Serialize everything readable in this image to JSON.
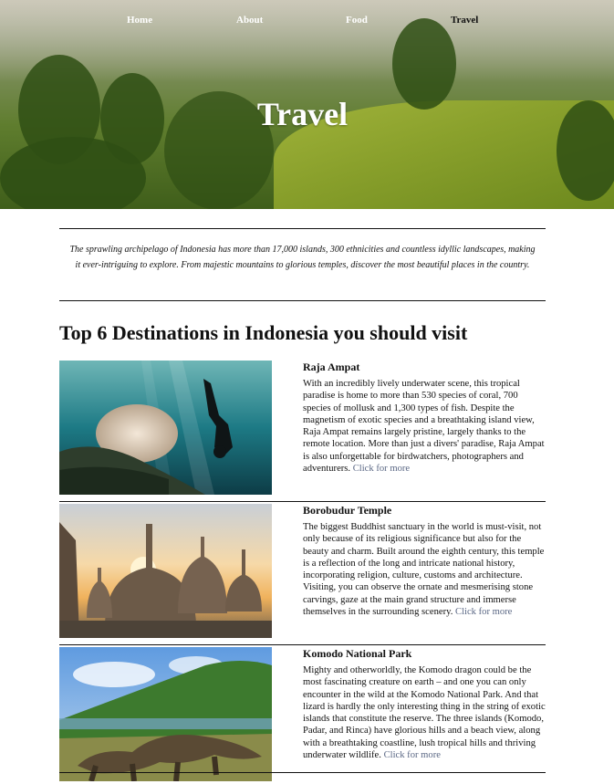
{
  "nav": [
    "Home",
    "About",
    "Food",
    "Travel"
  ],
  "hero": {
    "title": "Travel"
  },
  "intro": "The sprawling archipelago of Indonesia has more than 17,000 islands, 300 ethnicities and countless idyllic landscapes, making it ever-intriguing to explore. From majestic mountains to glorious temples, discover the most beautiful places in the country.",
  "section_title": "Top 6 Destinations in Indonesia you should visit",
  "destinations": [
    {
      "title": "Raja Ampat",
      "body": "With an incredibly lively underwater scene, this tropical paradise is home to more than 530 species of coral, 700 species of mollusk and 1,300 types of fish. Despite the magnetism of exotic species and a breathtaking island view, Raja Ampat remains largely pristine, largely thanks to the remote location. More than just a divers' paradise, Raja Ampat is also unforgettable for birdwatchers, photographers and adventurers.",
      "link": "Click for more",
      "image_icon": "underwater-diver-photo"
    },
    {
      "title": "Borobudur Temple",
      "body": "The biggest Buddhist sanctuary in the world is must-visit, not only because of its religious significance but also for the beauty and charm. Built around the eighth century, this temple is a reflection of the long and intricate national history, incorporating religion, culture, customs and architecture. Visiting, you can observe the ornate and mesmerising stone carvings, gaze at the main grand structure and immerse themselves in the surrounding scenery.",
      "link": "Click for more",
      "image_icon": "temple-stupa-photo"
    },
    {
      "title": "Komodo National Park",
      "body": "Mighty and otherworldly, the Komodo dragon could be the most fascinating creature on earth – and one you can only encounter in the wild at the Komodo National Park. And that lizard is hardly the only interesting thing in the string of exotic islands that constitute the reserve. The three islands (Komodo, Padar, and Rinca) have glorious hills and a beach view, along with a breathtaking coastline, lush tropical hills and thriving underwater wildlife.",
      "link": "Click for more",
      "image_icon": "komodo-dragon-photo"
    }
  ]
}
